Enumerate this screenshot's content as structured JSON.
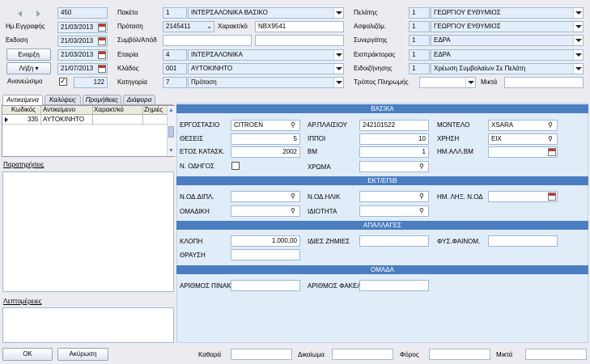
{
  "top": {
    "record_id": "450",
    "date_label": "Ημ.Εγγραφής",
    "date_value": "21/03/2013",
    "issue_label": "Εκδοση",
    "issue_value": "21/03/2013",
    "start_button": "Εναρξη",
    "start_value": "21/03/2013",
    "end_button": "Λήξη",
    "end_value": "21/07/2013",
    "renewable_label": "Ανανεώσιμο",
    "renewable_checked": true,
    "renewable_value": "122",
    "package_label": "Πακέτο",
    "package_code": "1",
    "package_name": "ΙΝΤΕΡΣΑΛΟΝΙΚΑ ΒΑΣΙΚΟ",
    "proposal_label": "Πρόταση",
    "proposal_value": "2145411",
    "char_label": "Χαρακτ/κό",
    "char_value": "ΝΒΧ9541",
    "contract_label": "Συμβόλ/Απόδ",
    "contract_value": "",
    "contract_value2": "",
    "company_label": "Εταιρία",
    "company_code": "4",
    "company_name": "ΙΝΤΕΡΣΑΛΟΝΙΚΑ",
    "branch_label": "Κλάδος",
    "branch_code": "001",
    "branch_name": "ΑΥΤΟΚΙΝΗΤΟ",
    "category_label": "Κατηγορία",
    "category_code": "7",
    "category_name": "Πρόταση",
    "client_label": "Πελάτης",
    "client_code": "1",
    "client_name": "ΓΕΩΡΓΙΟΥ ΕΥΘΥΜΙΟΣ",
    "insured_label": "Ασφαλιζόμ.",
    "insured_code": "1",
    "insured_name": "ΓΕΩΡΓΙΟΥ ΕΥΘΥΜΙΟΣ",
    "partner_label": "Συνεργάτης",
    "partner_code": "1",
    "partner_name": "ΕΔΡΑ",
    "collector_label": "Εισπράκτορας",
    "collector_code": "1",
    "collector_name": "ΕΔΡΑ",
    "notice_label": "Ειδοιζήνησης",
    "notice_code": "1",
    "notice_name": "Χρέωση Συμβολαίων Σε Πελάτη",
    "payment_label": "Τρόπος Πληρωμής",
    "payment_value": "",
    "mixed_label": "Μικτά",
    "mixed_value": ""
  },
  "tabs": [
    "Αντικείμενα",
    "Καλύψεις",
    "Προμήθειες",
    "Διάφορα"
  ],
  "grid": {
    "headers": [
      "Κωδικός",
      "Αντικείμενο",
      "Χαρακτ/κό",
      "Ζημιές"
    ],
    "rows": [
      {
        "code": "335",
        "object": "ΑΥΤΟΚΙΝΗΤΟ",
        "char": "",
        "damages": ""
      }
    ]
  },
  "notes_label": "Παρατηρήσεις",
  "details_label": "Λεπτομέρειες",
  "sections": {
    "basic": "ΒΑΣΙΚΑ",
    "ext": "ΕΚΤ/ΕΠΙΒ",
    "exempt": "ΑΠΑΛΛΑΓΕΣ",
    "group": "ΟΜΑΔΑ"
  },
  "fields": {
    "factory_label": "ΕΡΓΟΣΤΑΣΙΟ",
    "factory_value": "CITROEN",
    "chassis_label": "ΑΡ.ΠΛΑΙΣΙΟΥ",
    "chassis_value": "242101522",
    "model_label": "ΜΟΝΤΕΛΟ",
    "model_value": "XSARA",
    "seats_label": "ΘΕΣΕΙΣ",
    "seats_value": "5",
    "hp_label": "ΙΠΠΟΙ",
    "hp_value": "10",
    "use_label": "ΧΡΗΣΗ",
    "use_value": "ΕΙΧ",
    "year_label": "ΕΤΟΣ ΚΑΤΑΣΚ.",
    "year_value": "2002",
    "bm_label": "BM",
    "bm_value": "1",
    "bmdate_label": "ΗΜ.ΑΛΛ.ΒΜ",
    "bmdate_value": "",
    "driver_label": "Ν. ΟΔΗΓΟΣ",
    "color_label": "ΧΡΩΜΑ",
    "color_value": "",
    "nod_dipl_label": "Ν.ΟΔ.ΔΙΠΛ.",
    "nod_dipl_value": "",
    "nod_age_label": "Ν.ΟΔ.ΗΛΙΚ",
    "nod_age_value": "",
    "nod_exp_label": "ΗΜ. ΛΗΞ. Ν.ΟΔ",
    "nod_exp_value": "",
    "group_label": "ΟΜΑΔΙΚΗ",
    "group_value": "",
    "prop_label": "ΙΔΙΟΤΗΤΑ",
    "prop_value": "",
    "theft_label": "ΚΛΟΠΗ",
    "theft_value": "1.000,00",
    "own_label": "ΙΔΙΕΣ ΖΗΜΙΕΣ",
    "own_value": "",
    "nature_label": "ΦΥΣ.ΦΑΙΝΟΜ.",
    "nature_value": "",
    "break_label": "ΘΡΑΥΣΗ",
    "break_value": "",
    "table_num_label": "ΑΡΙΘΜΟΣ ΠΙΝΑΚ",
    "table_num_value": "",
    "folder_num_label": "ΑΡΙΘΜΟΣ ΦΑΚΕΛ",
    "folder_num_value": ""
  },
  "footer": {
    "ok": "OK",
    "cancel": "Ακύρωση",
    "net_label": "Καθαρά",
    "net_value": "",
    "right_label": "Δικαίωμα",
    "right_value": "",
    "tax_label": "Φόρος",
    "tax_value": "",
    "gross_label": "Μικτά",
    "gross_value": ""
  }
}
